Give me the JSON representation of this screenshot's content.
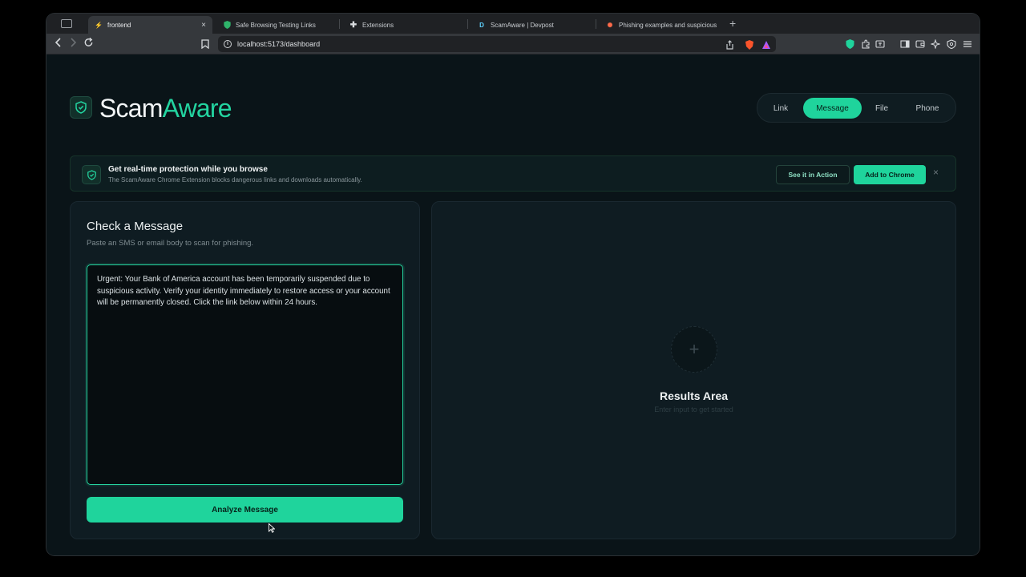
{
  "browser": {
    "tabs": [
      {
        "title": "frontend",
        "active": true
      },
      {
        "title": "Safe Browsing Testing Links",
        "active": false
      },
      {
        "title": "Extensions",
        "active": false
      },
      {
        "title": "ScamAware | Devpost",
        "active": false
      },
      {
        "title": "Phishing examples and suspicious",
        "active": false
      }
    ],
    "url": "localhost:5173/dashboard",
    "new_tab": "+",
    "close_tab": "×"
  },
  "brand": {
    "part1": "Scam",
    "part2": "Aware"
  },
  "modes": [
    {
      "label": "Link",
      "active": false
    },
    {
      "label": "Message",
      "active": true
    },
    {
      "label": "File",
      "active": false
    },
    {
      "label": "Phone",
      "active": false
    }
  ],
  "banner": {
    "title": "Get real-time protection while you browse",
    "subtitle": "The ScamAware Chrome Extension blocks dangerous links and downloads automatically.",
    "see_action": "See it in Action",
    "add_chrome": "Add to Chrome",
    "close": "×"
  },
  "check": {
    "title": "Check a Message",
    "subtitle": "Paste an SMS or email body to scan for phishing.",
    "message": "Urgent: Your Bank of America account has been temporarily suspended due to suspicious activity. Verify your identity immediately to restore access or your account will be permanently closed. Click the link below within 24 hours.",
    "button": "Analyze Message"
  },
  "results": {
    "plus": "+",
    "title": "Results Area",
    "subtitle": "Enter input to get started"
  },
  "colors": {
    "accent": "#1fd49c",
    "background": "#0a1418"
  }
}
